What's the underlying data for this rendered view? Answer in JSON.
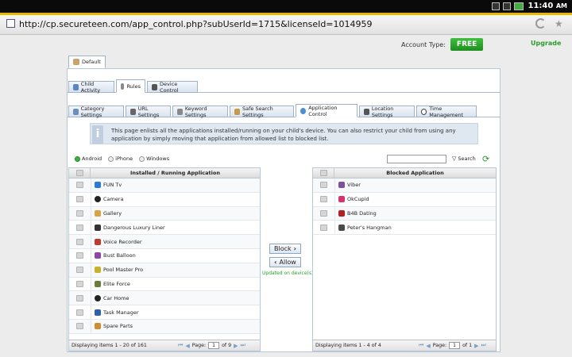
{
  "statusbar": {
    "time": "11:40",
    "time_suffix": "AM",
    "icons": [
      "signal-icon",
      "wifi-icon",
      "battery-icon"
    ]
  },
  "browser": {
    "url": "http://cp.secureteen.com/app_control.php?subUserId=1715&licenseId=1014959"
  },
  "account": {
    "label": "Account Type:",
    "type": "FREE",
    "upgrade": "Upgrade"
  },
  "user_tab": {
    "label": "Default"
  },
  "main_tabs": [
    {
      "label": "Child Activity"
    },
    {
      "label": "Rules"
    },
    {
      "label": "Device Control"
    }
  ],
  "sub_tabs": [
    {
      "label": "Category Settings"
    },
    {
      "label": "URL Settings"
    },
    {
      "label": "Keyword Settings"
    },
    {
      "label": "Safe Search Settings"
    },
    {
      "label": "Application Control"
    },
    {
      "label": "Location Settings"
    },
    {
      "label": "Time Management"
    }
  ],
  "info": {
    "text": "This page enlists all the applications installed/running on your child's device. You can also restrict your child from using any application by simply moving that application from allowed list to blocked list."
  },
  "platforms": [
    {
      "label": "Android",
      "selected": true
    },
    {
      "label": "iPhone",
      "selected": false
    },
    {
      "label": "Windows",
      "selected": false
    }
  ],
  "search": {
    "button": "Search",
    "value": ""
  },
  "left_grid": {
    "header": "Installed / Running Application",
    "rows": [
      "FUN Tv",
      "Camera",
      "Gallery",
      "Dangerous Luxury Liner",
      "Voice Recorder",
      "Bust Balloon",
      "Pool Master Pro",
      "Elite Force",
      "Car Home",
      "Task Manager",
      "Spare Parts"
    ],
    "footer": "Displaying items 1 - 20 of 161",
    "page_label": "Page:",
    "page": "1",
    "of_label": "of 9"
  },
  "right_grid": {
    "header": "Blocked Application",
    "rows": [
      "Viber",
      "OkCupid",
      "B4B Dating",
      "Peter's Hangman"
    ],
    "footer": "Displaying items 1 - 4 of 4",
    "page_label": "Page:",
    "page": "1",
    "of_label": "of 1"
  },
  "actions": {
    "block": "Block",
    "allow": "Allow",
    "status": "Updated on device(s)"
  },
  "colors": {
    "accent_green": "#2a9d2a",
    "progress": "#e8b800"
  }
}
